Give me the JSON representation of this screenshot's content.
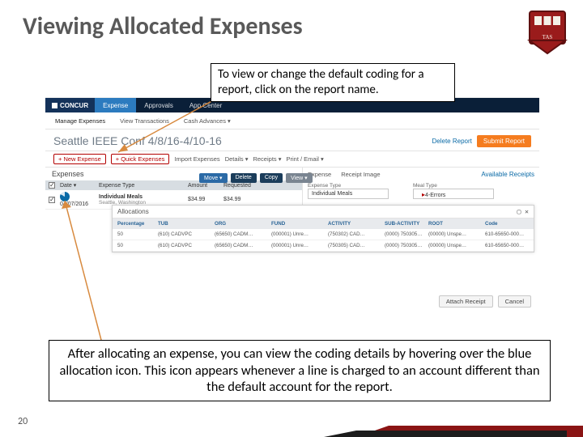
{
  "slide": {
    "title": "Viewing Allocated Expenses",
    "page_number": "20"
  },
  "callouts": {
    "top": "To view or change the default coding for a report, click on the report name.",
    "bottom": "After allocating an expense, you can view the coding details by hovering over the blue allocation icon. This icon appears whenever a line is charged to an account different than the default account for the report."
  },
  "concur": {
    "brand": "CONCUR",
    "topnav": [
      "Expense",
      "Approvals",
      "App Center"
    ],
    "subnav": [
      "Manage Expenses",
      "View Transactions",
      "Cash Advances ▾"
    ],
    "report_name": "Seattle IEEE Conf 4/8/16-4/10-16",
    "header_actions": {
      "delete": "Delete Report",
      "submit": "Submit Report"
    },
    "toolbar": {
      "new_expense": "+ New Expense",
      "quick_expenses": "+ Quick Expenses",
      "import": "Import Expenses",
      "details": "Details ▾",
      "receipts": "Receipts ▾",
      "print": "Print / Email ▾"
    },
    "expenses": {
      "title": "Expenses",
      "buttons": {
        "move": "Move ▾",
        "delete": "Delete",
        "copy": "Copy",
        "view": "View ▾"
      },
      "columns": [
        "",
        "Date ▾",
        "Expense Type",
        "Amount",
        "Requested"
      ],
      "row": {
        "date": "04/07/2016",
        "type": "Individual Meals",
        "loc": "Seattle, Washington",
        "amount": "$34.99",
        "requested": "$34.99"
      }
    },
    "right": {
      "tabs": [
        "Expense",
        "Receipt Image"
      ],
      "available": "Available Receipts",
      "fields": {
        "expense_type": "Expense Type",
        "meal_type": "Meal Type"
      },
      "values": {
        "expense_type": "Individual Meals",
        "meal_type": "4-Errors"
      }
    },
    "allocations": {
      "title": "Allocations",
      "headers": [
        "Percentage",
        "TUB",
        "ORG",
        "FUND",
        "ACTIVITY",
        "SUB-ACTIVITY",
        "ROOT",
        "Code"
      ],
      "rows": [
        [
          "50",
          "(610) CADVPC",
          "(65650) CADM…",
          "(000001) Unre…",
          "(750302) CAD…",
          "(0000) 750305…",
          "(00000) Unspe…",
          "610-65650-000…"
        ],
        [
          "50",
          "(610) CADVPC",
          "(65650) CADM…",
          "(000001) Unre…",
          "(750305) CAD…",
          "(0000) 750305…",
          "(00000) Unspe…",
          "610-65650-000…"
        ]
      ]
    },
    "footer": {
      "attach": "Attach Receipt",
      "cancel": "Cancel"
    }
  }
}
